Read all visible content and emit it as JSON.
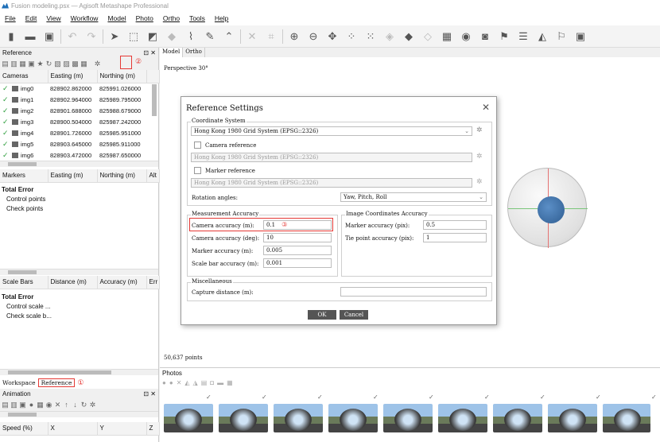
{
  "window": {
    "title": "Fusion modeling.psx — Agisoft Metashape Professional"
  },
  "menu": [
    "File",
    "Edit",
    "View",
    "Workflow",
    "Model",
    "Photo",
    "Ortho",
    "Tools",
    "Help"
  ],
  "reference": {
    "title": "Reference",
    "marker_tools": "②",
    "columns": [
      "Cameras",
      "Easting (m)",
      "Northing (m)"
    ],
    "cameras": [
      {
        "name": "img0",
        "easting": "828902.862000",
        "northing": "825991.026000"
      },
      {
        "name": "img1",
        "easting": "828902.964000",
        "northing": "825989.795000"
      },
      {
        "name": "img2",
        "easting": "828901.688000",
        "northing": "825988.679000"
      },
      {
        "name": "img3",
        "easting": "828900.504000",
        "northing": "825987.242000"
      },
      {
        "name": "img4",
        "easting": "828901.726000",
        "northing": "825985.951000"
      },
      {
        "name": "img5",
        "easting": "828903.645000",
        "northing": "825985.911000"
      },
      {
        "name": "img6",
        "easting": "828903.472000",
        "northing": "825987.650000"
      }
    ],
    "marker_columns": [
      "Markers",
      "Easting (m)",
      "Northing (m)",
      "Alt"
    ],
    "markers_total": "Total Error",
    "control_points": "Control points",
    "check_points": "Check points",
    "scalebar_columns": [
      "Scale Bars",
      "Distance (m)",
      "Accuracy (m)",
      "Err"
    ],
    "scale_total": "Total Error",
    "control_scale": "Control scale ...",
    "check_scale": "Check scale b..."
  },
  "tabs": {
    "workspace": "Workspace",
    "reference": "Reference",
    "marker": "①"
  },
  "animation": {
    "title": "Animation",
    "columns": [
      "Speed (%)",
      "X",
      "Y",
      "Z"
    ]
  },
  "main": {
    "tabs": [
      "Model",
      "Ortho"
    ],
    "perspective": "Perspective 30°",
    "points": "50,637 points"
  },
  "photos": {
    "title": "Photos"
  },
  "dialog": {
    "title": "Reference Settings",
    "coord_group": "Coordinate System",
    "coord_system": "Hong Kong 1980 Grid System (EPSG::2326)",
    "camera_ref_label": "Camera reference",
    "camera_ref_value": "Hong Kong 1980 Grid System (EPSG::2326)",
    "marker_ref_label": "Marker reference",
    "marker_ref_value": "Hong Kong 1980 Grid System (EPSG::2326)",
    "rotation_label": "Rotation angles:",
    "rotation_value": "Yaw, Pitch, Roll",
    "meas_group": "Measurement Accuracy",
    "cam_acc_m_label": "Camera accuracy (m):",
    "cam_acc_m": "0.1",
    "cam_acc_marker": "③",
    "cam_acc_deg_label": "Camera accuracy (deg):",
    "cam_acc_deg": "10",
    "marker_acc_label": "Marker accuracy (m):",
    "marker_acc": "0.005",
    "scalebar_acc_label": "Scale bar accuracy (m):",
    "scalebar_acc": "0.001",
    "img_group": "Image Coordinates Accuracy",
    "marker_pix_label": "Marker accuracy (pix):",
    "marker_pix": "0.5",
    "tie_pix_label": "Tie point accuracy (pix):",
    "tie_pix": "1",
    "misc_group": "Miscellaneous",
    "capture_label": "Capture distance (m):",
    "capture_value": "",
    "ok": "OK",
    "cancel": "Cancel"
  }
}
